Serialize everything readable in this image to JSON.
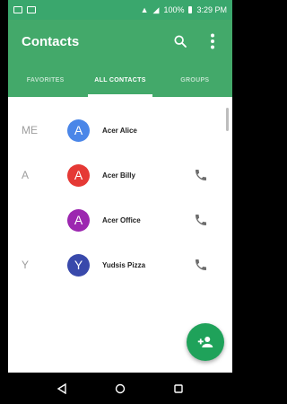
{
  "status_bar": {
    "battery_text": "100%",
    "time": "3:29 PM"
  },
  "app_bar": {
    "title": "Contacts"
  },
  "tabs": [
    {
      "label": "FAVORITES",
      "active": false
    },
    {
      "label": "ALL CONTACTS",
      "active": true
    },
    {
      "label": "GROUPS",
      "active": false
    }
  ],
  "contacts": [
    {
      "section": "ME",
      "initial": "A",
      "name": "Acer Alice",
      "color": "#4a86e8",
      "has_call": false
    },
    {
      "section": "A",
      "initial": "A",
      "name": "Acer Billy",
      "color": "#e53935",
      "has_call": true
    },
    {
      "section": "",
      "initial": "A",
      "name": "Acer Office",
      "color": "#9c27b0",
      "has_call": true
    },
    {
      "section": "Y",
      "initial": "Y",
      "name": "Yudsis Pizza",
      "color": "#3949ab",
      "has_call": true
    }
  ],
  "colors": {
    "primary": "#43a96a",
    "status_bar": "#3aa76d",
    "fab": "#1fa25a",
    "call_icon": "#6d6d6d"
  },
  "icons": {
    "search": "search-icon",
    "overflow": "more-vert-icon",
    "call": "phone-icon",
    "fab": "add-contact-icon",
    "nav_back": "back-icon",
    "nav_home": "home-icon",
    "nav_recents": "recents-icon"
  }
}
